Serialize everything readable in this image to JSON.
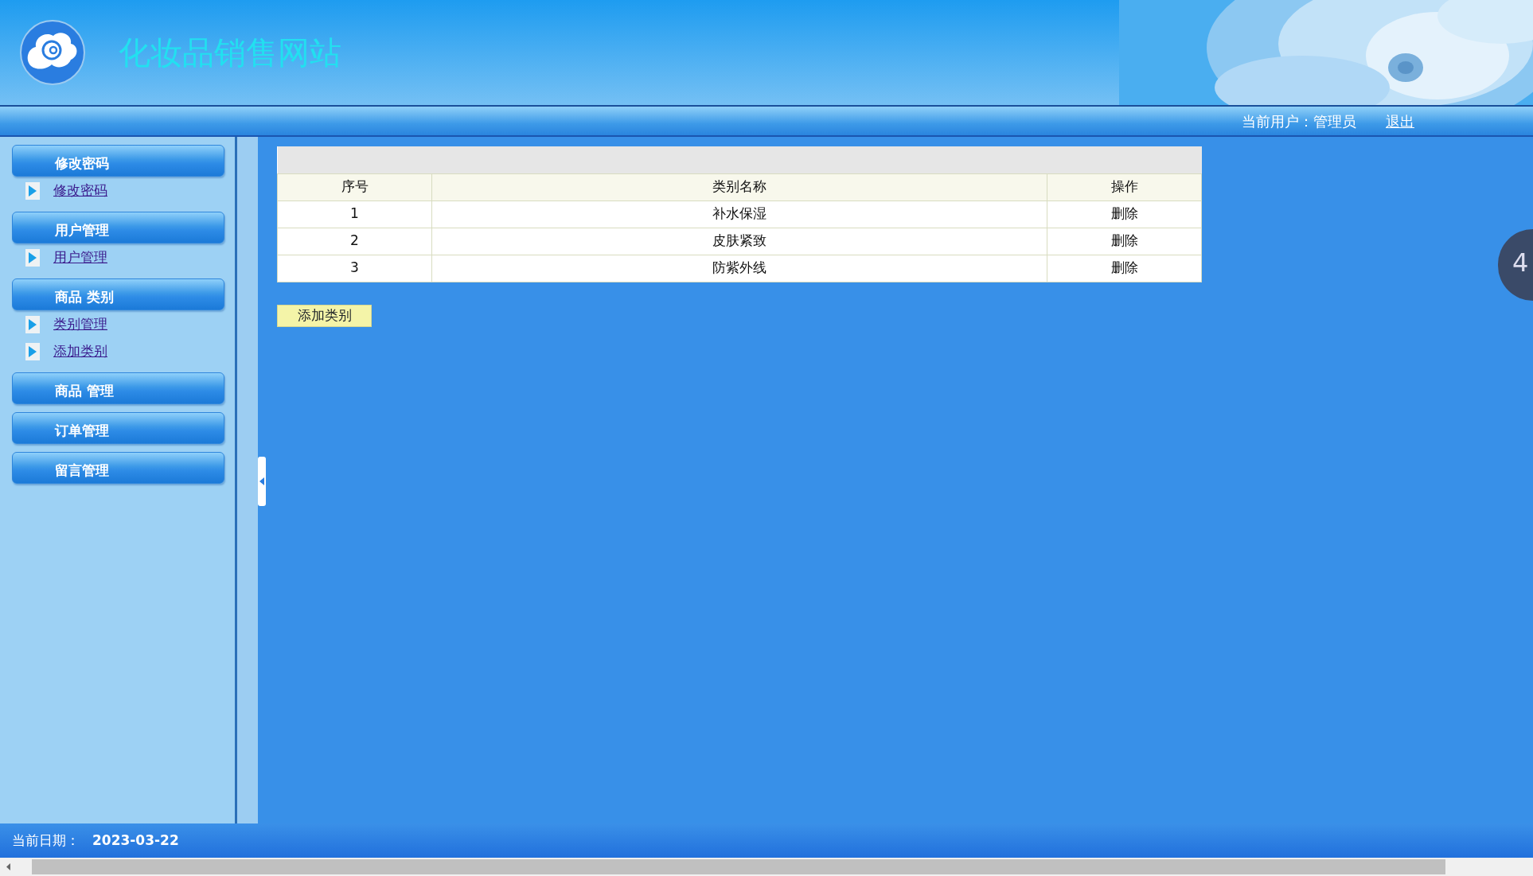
{
  "header": {
    "title": "化妆品销售网站"
  },
  "topbar": {
    "user": "当前用户：管理员",
    "logout": "退出"
  },
  "sidebar": {
    "groups": [
      {
        "title": "修改密码",
        "items": [
          {
            "label": "修改密码"
          }
        ]
      },
      {
        "title": "用户管理",
        "items": [
          {
            "label": "用户管理"
          }
        ]
      },
      {
        "title": "商品 类别",
        "items": [
          {
            "label": "类别管理"
          },
          {
            "label": "添加类别"
          }
        ]
      },
      {
        "title": "商品 管理"
      },
      {
        "title": "订单管理"
      },
      {
        "title": "留言管理"
      }
    ]
  },
  "table": {
    "columns": [
      "序号",
      "类别名称",
      "操作"
    ],
    "rows": [
      [
        "1",
        "补水保湿",
        "删除"
      ],
      [
        "2",
        "皮肤紧致",
        "删除"
      ],
      [
        "3",
        "防紫外线",
        "删除"
      ]
    ]
  },
  "add_button": "添加类别",
  "floating_badge": "4",
  "footer": {
    "label": "当前日期：",
    "date": "2023-03-22"
  }
}
